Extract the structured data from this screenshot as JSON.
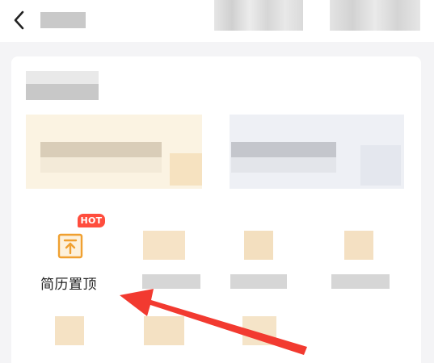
{
  "header": {
    "back_icon": "chevron-left-icon"
  },
  "features": {
    "top_resume": {
      "label": "简历置顶",
      "badge": "HOT",
      "icon": "arrow-up-to-top-icon"
    }
  },
  "colors": {
    "accent": "#ff4d3d",
    "icon_orange": "#f0a030",
    "annotation_arrow": "#f23a30",
    "page_background": "#f4f4f6"
  },
  "annotation": {
    "type": "arrow",
    "points_to": "top_resume"
  }
}
